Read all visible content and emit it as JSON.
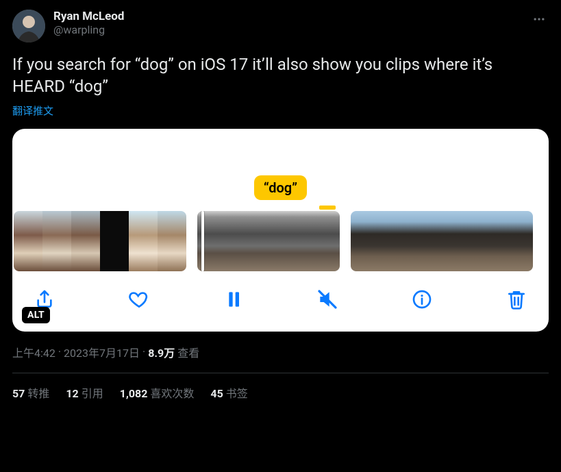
{
  "author": {
    "display_name": "Ryan McLeod",
    "handle": "@warpling"
  },
  "body": "If you search for “dog” on iOS 17 it’ll also show you clips where it’s HEARD “dog”",
  "translate": "翻译推文",
  "media": {
    "search_bubble": "“dog”",
    "alt_badge": "ALT",
    "icons": {
      "share": "share-icon",
      "heart": "heart-icon",
      "pause": "pause-icon",
      "mute": "mute-icon",
      "info": "info-icon",
      "trash": "trash-icon"
    }
  },
  "meta": {
    "time": "上午4:42",
    "sep": " · ",
    "date": "2023年7月17日",
    "views_count": "8.9万",
    "views_label": " 查看"
  },
  "stats": {
    "retweets_n": "57",
    "retweets_label": "转推",
    "quotes_n": "12",
    "quotes_label": "引用",
    "likes_n": "1,082",
    "likes_label": "喜欢次数",
    "bookmarks_n": "45",
    "bookmarks_label": "书签"
  }
}
